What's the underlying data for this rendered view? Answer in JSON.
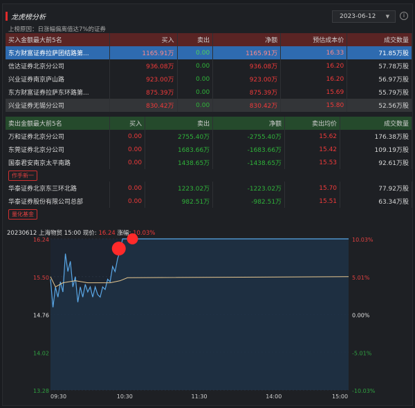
{
  "header": {
    "title": "龙虎榜分析",
    "date": "2023-06-12",
    "info_icon": "info-icon"
  },
  "reason": "上榜原因：日涨幅偏离值达7%的证券",
  "buy_table": {
    "headers": [
      "买入金额最大前5名",
      "买入",
      "卖出",
      "净额",
      "预估成本价",
      "成交数量"
    ],
    "rows": [
      [
        "东方财富证券拉萨团结路第...",
        "1165.91万",
        "0.00",
        "1165.91万",
        "16.33",
        "71.85万股"
      ],
      [
        "信达证券北京分公司",
        "936.08万",
        "0.00",
        "936.08万",
        "16.20",
        "57.78万股"
      ],
      [
        "兴业证券南京庐山路",
        "923.00万",
        "0.00",
        "923.00万",
        "16.20",
        "56.97万股"
      ],
      [
        "东方财富证券拉萨东环路第...",
        "875.39万",
        "0.00",
        "875.39万",
        "15.69",
        "55.79万股"
      ],
      [
        "兴业证券无锡分公司",
        "830.42万",
        "0.00",
        "830.42万",
        "15.80",
        "52.56万股"
      ]
    ]
  },
  "sell_table": {
    "headers": [
      "卖出金额最大前5名",
      "买入",
      "卖出",
      "净额",
      "卖出均价",
      "成交数量"
    ],
    "rows": [
      [
        "万和证券北京分公司",
        "0.00",
        "2755.40万",
        "-2755.40万",
        "15.62",
        "176.38万股"
      ],
      [
        "东莞证券北京分公司",
        "0.00",
        "1683.66万",
        "-1683.66万",
        "15.42",
        "109.19万股"
      ],
      [
        "国泰君安南京太平南路",
        "0.00",
        "1438.65万",
        "-1438.65万",
        "15.53",
        "92.61万股"
      ],
      [
        "华泰证券北京东三环北路",
        "0.00",
        "1223.02万",
        "-1223.02万",
        "15.70",
        "77.92万股"
      ],
      [
        "华泰证券股份有限公司总部",
        "0.00",
        "982.51万",
        "-982.51万",
        "15.51",
        "63.34万股"
      ]
    ],
    "tags": [
      "作手新一",
      "量化基金"
    ]
  },
  "quote": {
    "date": "20230612",
    "name": "上海物贸",
    "time": "15:00",
    "price_label": "现价:",
    "price": "16.24",
    "change_label": "涨幅:",
    "change": "10.03%"
  },
  "chart_data": {
    "type": "line",
    "title": "分时图",
    "prev_close": 14.76,
    "ylim": [
      13.28,
      16.24
    ],
    "y_ticks": [
      "16.24",
      "15.50",
      "14.76",
      "14.02",
      "13.28"
    ],
    "y2_ticks": [
      "10.03%",
      "5.01%",
      "0.00%",
      "-5.01%",
      "-10.03%"
    ],
    "x_ticks": [
      "09:30",
      "10:30",
      "11:30",
      "14:00",
      "15:00"
    ],
    "x_minutes_range": [
      0,
      240
    ],
    "price_series": [
      [
        0,
        15.45
      ],
      [
        2,
        14.9
      ],
      [
        4,
        15.3
      ],
      [
        6,
        15.1
      ],
      [
        8,
        15.4
      ],
      [
        10,
        15.2
      ],
      [
        12,
        15.95
      ],
      [
        14,
        15.6
      ],
      [
        16,
        15.8
      ],
      [
        18,
        15.3
      ],
      [
        20,
        15.5
      ],
      [
        22,
        15.0
      ],
      [
        24,
        15.3
      ],
      [
        26,
        15.1
      ],
      [
        28,
        15.35
      ],
      [
        30,
        15.2
      ],
      [
        32,
        15.3
      ],
      [
        34,
        15.1
      ],
      [
        36,
        15.3
      ],
      [
        38,
        15.15
      ],
      [
        40,
        15.1
      ],
      [
        42,
        15.3
      ],
      [
        44,
        15.25
      ],
      [
        46,
        15.45
      ],
      [
        48,
        15.4
      ],
      [
        50,
        15.7
      ],
      [
        52,
        15.6
      ],
      [
        54,
        15.85
      ],
      [
        56,
        16.0
      ],
      [
        58,
        16.24
      ],
      [
        240,
        16.24
      ]
    ],
    "avg_series": [
      [
        0,
        15.5
      ],
      [
        4,
        15.3
      ],
      [
        10,
        15.38
      ],
      [
        20,
        15.42
      ],
      [
        30,
        15.38
      ],
      [
        48,
        15.38
      ],
      [
        56,
        15.42
      ],
      [
        62,
        15.48
      ],
      [
        240,
        15.5
      ]
    ],
    "markers": [
      [
        55,
        16.05
      ],
      [
        66,
        16.24
      ]
    ],
    "colors": {
      "price": "#5aa8e8",
      "avg": "#e8c890",
      "marker": "#ff2a2a",
      "up": "#e04040",
      "down": "#30a040"
    }
  }
}
